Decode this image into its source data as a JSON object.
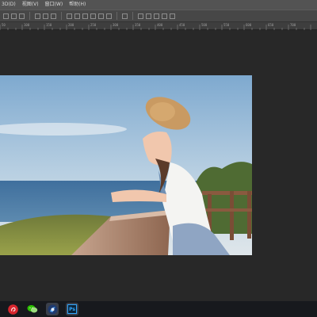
{
  "menu": {
    "items": [
      "3D(D)",
      "视图(V)",
      "窗口(W)",
      "帮助(H)"
    ]
  },
  "ruler": {
    "ticks": [
      "50",
      "100",
      "150",
      "200",
      "250",
      "300",
      "350",
      "400",
      "450",
      "500",
      "550",
      "600",
      "650",
      "700"
    ]
  },
  "taskbar": {
    "apps": [
      {
        "name": "NetEase Music",
        "icon": "netease-music-icon"
      },
      {
        "name": "WeChat",
        "icon": "wechat-icon"
      },
      {
        "name": "Maxthon",
        "icon": "browser-icon"
      },
      {
        "name": "Photoshop",
        "icon": "photoshop-icon",
        "label": "Ps"
      }
    ]
  },
  "colors": {
    "menubar": "#535353",
    "optionsbar": "#474747",
    "workspace": "#282828",
    "taskbar": "#17191d",
    "ps_blue": "#31a8ff"
  }
}
